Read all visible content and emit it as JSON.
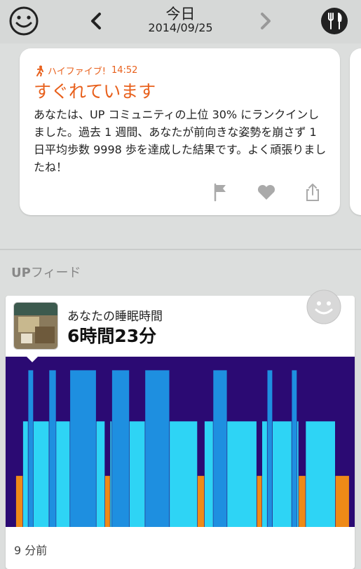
{
  "header": {
    "title": "今日",
    "date": "2014/09/25"
  },
  "highlight": {
    "meta_label": "ハイファイブ!",
    "time": "14:52",
    "title": "すぐれています",
    "body": "あなたは、UP コミュニティの上位 30% にランクインしました。過去 1 週間、あなたが前向きな姿勢を崩さず 1 日平均歩数 9998 歩を達成した結果です。よく頑張りましたね！"
  },
  "feed": {
    "label_bold": "UP",
    "label_rest": "フィード"
  },
  "sleep": {
    "title": "あなたの睡眠時間",
    "value": "6時間23分",
    "time_ago": "9 分前"
  },
  "colors": {
    "accent": "#e8601c",
    "awake": "#ef8a17",
    "light_sleep": "#2ed4f5",
    "sound_sleep": "#1e8fe0",
    "chart_bg": "#2b0a73"
  },
  "chart_data": {
    "type": "bar",
    "description_levels": [
      "awake",
      "light_sleep",
      "sound_sleep"
    ],
    "segments": [
      {
        "level": "awake",
        "start": 0.03,
        "end": 0.05
      },
      {
        "level": "light_sleep",
        "start": 0.05,
        "end": 0.065
      },
      {
        "level": "sound_sleep",
        "start": 0.065,
        "end": 0.08
      },
      {
        "level": "light_sleep",
        "start": 0.08,
        "end": 0.125
      },
      {
        "level": "sound_sleep",
        "start": 0.125,
        "end": 0.145
      },
      {
        "level": "light_sleep",
        "start": 0.145,
        "end": 0.185
      },
      {
        "level": "sound_sleep",
        "start": 0.185,
        "end": 0.26
      },
      {
        "level": "light_sleep",
        "start": 0.26,
        "end": 0.285
      },
      {
        "level": "awake",
        "start": 0.285,
        "end": 0.3
      },
      {
        "level": "light_sleep",
        "start": 0.3,
        "end": 0.305
      },
      {
        "level": "sound_sleep",
        "start": 0.305,
        "end": 0.355
      },
      {
        "level": "light_sleep",
        "start": 0.355,
        "end": 0.4
      },
      {
        "level": "sound_sleep",
        "start": 0.4,
        "end": 0.47
      },
      {
        "level": "light_sleep",
        "start": 0.47,
        "end": 0.55
      },
      {
        "level": "awake",
        "start": 0.55,
        "end": 0.57
      },
      {
        "level": "light_sleep",
        "start": 0.57,
        "end": 0.595
      },
      {
        "level": "sound_sleep",
        "start": 0.595,
        "end": 0.635
      },
      {
        "level": "light_sleep",
        "start": 0.635,
        "end": 0.72
      },
      {
        "level": "awake",
        "start": 0.72,
        "end": 0.735
      },
      {
        "level": "light_sleep",
        "start": 0.735,
        "end": 0.75
      },
      {
        "level": "sound_sleep",
        "start": 0.75,
        "end": 0.765
      },
      {
        "level": "light_sleep",
        "start": 0.765,
        "end": 0.82
      },
      {
        "level": "sound_sleep",
        "start": 0.82,
        "end": 0.835
      },
      {
        "level": "light_sleep",
        "start": 0.835,
        "end": 0.84
      },
      {
        "level": "awake",
        "start": 0.84,
        "end": 0.86
      },
      {
        "level": "light_sleep",
        "start": 0.86,
        "end": 0.945
      },
      {
        "level": "awake",
        "start": 0.945,
        "end": 0.985
      }
    ]
  }
}
